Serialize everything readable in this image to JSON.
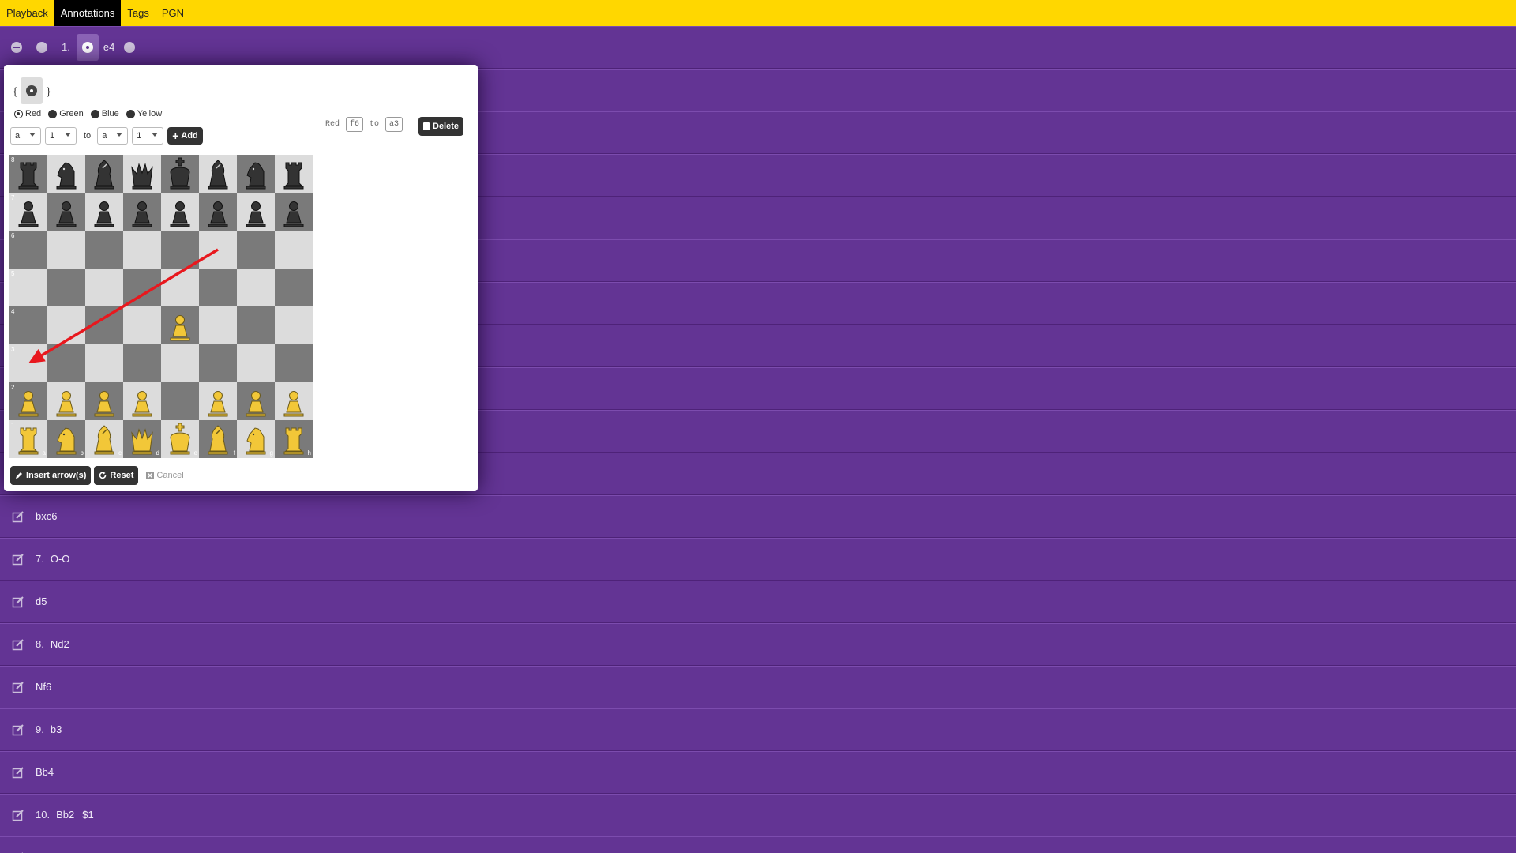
{
  "nav": {
    "items": [
      {
        "label": "Playback",
        "active": false
      },
      {
        "label": "Annotations",
        "active": true
      },
      {
        "label": "Tags",
        "active": false
      },
      {
        "label": "PGN",
        "active": false
      }
    ]
  },
  "first_row": {
    "move_number": "1.",
    "move": "e4"
  },
  "rows": [
    {
      "num": "",
      "move": "bxc6",
      "nag": ""
    },
    {
      "num": "7.",
      "move": "O-O",
      "nag": ""
    },
    {
      "num": "",
      "move": "d5",
      "nag": ""
    },
    {
      "num": "8.",
      "move": "Nd2",
      "nag": ""
    },
    {
      "num": "",
      "move": "Nf6",
      "nag": ""
    },
    {
      "num": "9.",
      "move": "b3",
      "nag": ""
    },
    {
      "num": "",
      "move": "Bb4",
      "nag": ""
    },
    {
      "num": "10.",
      "move": "Bb2",
      "nag": "$1"
    }
  ],
  "modal": {
    "brace_open": "{",
    "brace_close": "}",
    "colors": [
      {
        "label": "Red",
        "checked": true
      },
      {
        "label": "Green",
        "checked": false
      },
      {
        "label": "Blue",
        "checked": false
      },
      {
        "label": "Yellow",
        "checked": false
      }
    ],
    "from_file": "a",
    "from_rank": "1",
    "to_label": "to",
    "to_file": "a",
    "to_rank": "1",
    "add_label": "Add",
    "arrow": {
      "color": "Red",
      "from": "f6",
      "to_word": "to",
      "to": "a3"
    },
    "delete_label": "Delete",
    "insert_label": "Insert arrow(s)",
    "reset_label": "Reset",
    "cancel_label": "Cancel",
    "arrow_color": "#e8181e",
    "board": {
      "ranks": [
        "8",
        "7",
        "6",
        "5",
        "4",
        "3",
        "2",
        "1"
      ],
      "files": [
        "a",
        "b",
        "c",
        "d",
        "e",
        "f",
        "g",
        "h"
      ],
      "position": [
        [
          "bR",
          "bN",
          "bB",
          "bQ",
          "bK",
          "bB",
          "bN",
          "bR"
        ],
        [
          "bP",
          "bP",
          "bP",
          "bP",
          "bP",
          "bP",
          "bP",
          "bP"
        ],
        [
          "",
          "",
          "",
          "",
          "",
          "",
          "",
          ""
        ],
        [
          "",
          "",
          "",
          "",
          "",
          "",
          "",
          ""
        ],
        [
          "",
          "",
          "",
          "",
          "wP",
          "",
          "",
          ""
        ],
        [
          "",
          "",
          "",
          "",
          "",
          "",
          "",
          ""
        ],
        [
          "wP",
          "wP",
          "wP",
          "wP",
          "",
          "wP",
          "wP",
          "wP"
        ],
        [
          "wR",
          "wN",
          "wB",
          "wQ",
          "wK",
          "wB",
          "wN",
          "wR"
        ]
      ],
      "white_color": "#f2c738",
      "black_color": "#333333"
    }
  }
}
